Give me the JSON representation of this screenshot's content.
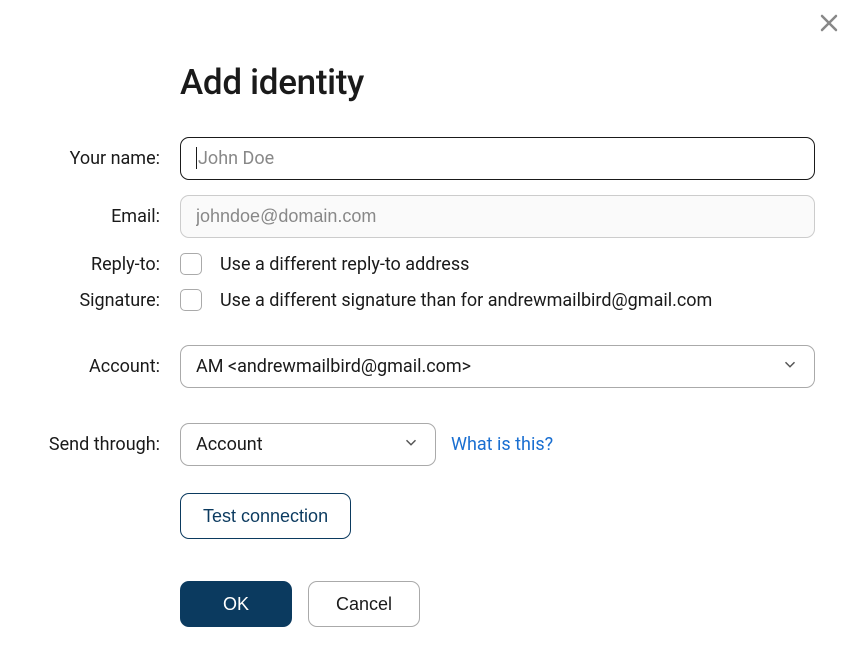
{
  "dialog": {
    "title": "Add identity"
  },
  "labels": {
    "name": "Your name:",
    "email": "Email:",
    "reply_to": "Reply-to:",
    "signature": "Signature:",
    "account": "Account:",
    "send_through": "Send through:"
  },
  "fields": {
    "name_placeholder": "John Doe",
    "name_value": "",
    "email_placeholder": "johndoe@domain.com",
    "email_value": "",
    "reply_to_label": "Use a different reply-to address",
    "signature_label": "Use a different signature than for andrewmailbird@gmail.com",
    "account_selected": "AM <andrewmailbird@gmail.com>",
    "send_through_selected": "Account"
  },
  "links": {
    "what_is_this": "What is this?"
  },
  "buttons": {
    "test_connection": "Test connection",
    "ok": "OK",
    "cancel": "Cancel"
  }
}
